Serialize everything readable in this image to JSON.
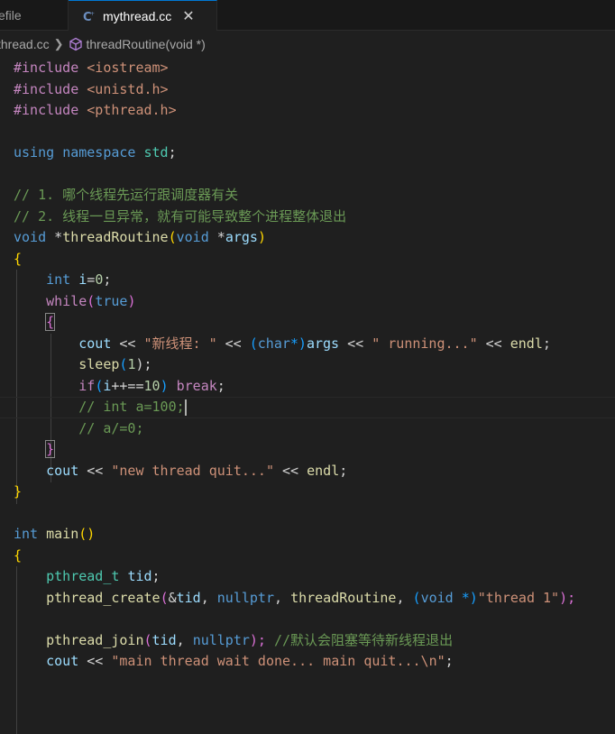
{
  "tabs": [
    {
      "label": "efile",
      "active": false
    },
    {
      "label": "mythread.cc",
      "active": true,
      "close": "✕"
    }
  ],
  "breadcrumb": {
    "file": "thread.cc",
    "symbol": "threadRoutine(void *)"
  },
  "code": {
    "l1": [
      "#include",
      " ",
      "<iostream>"
    ],
    "l2": [
      "#include",
      " ",
      "<unistd.h>"
    ],
    "l3": [
      "#include",
      " ",
      "<pthread.h>"
    ],
    "l5": [
      "using",
      "namespace",
      "std",
      ";"
    ],
    "l7": "// 1. 哪个线程先运行跟调度器有关",
    "l8": "// 2. 线程一旦异常，就有可能导致整个进程整体退出",
    "l9": [
      "void",
      "*",
      "threadRoutine",
      "(",
      "void",
      "*",
      "args",
      ")"
    ],
    "l11": [
      "int",
      "i",
      "=",
      "0",
      ";"
    ],
    "l12": [
      "while",
      "(",
      "true",
      ")"
    ],
    "l14": [
      "cout",
      " << ",
      "\"新线程: \"",
      " << ",
      "(",
      "char",
      "*)",
      "args",
      " << ",
      "\" running...\"",
      " << ",
      "endl",
      ";"
    ],
    "l15": [
      "sleep",
      "(",
      "1",
      ");"
    ],
    "l16": [
      "if",
      "(",
      "i",
      "++==",
      "10",
      ")",
      " ",
      "break",
      ";"
    ],
    "l17": "// int a=100;",
    "l18": "// a/=0;",
    "l20": [
      "cout",
      " << ",
      "\"new thread quit...\"",
      " << ",
      "endl",
      ";"
    ],
    "l23": [
      "int",
      "main",
      "()"
    ],
    "l25": [
      "pthread_t",
      "tid",
      ";"
    ],
    "l26": [
      "pthread_create",
      "(",
      "&",
      "tid",
      ", ",
      "nullptr",
      ", ",
      "threadRoutine",
      ", ",
      "(",
      "void",
      " *)",
      "\"thread 1\"",
      ");"
    ],
    "l28": [
      "pthread_join",
      "(",
      "tid",
      ", ",
      "nullptr",
      ");",
      " ",
      "//默认会阻塞等待新线程退出"
    ],
    "l29": [
      "cout",
      " << ",
      "\"main thread wait done... main quit...\\n\"",
      ";"
    ]
  },
  "colors": {
    "background": "#1f1f1f",
    "keyword": "#569cd6",
    "control": "#c586c0",
    "string": "#ce9178",
    "comment": "#6a9955",
    "function": "#dcdcaa",
    "variable": "#9cdcfe",
    "type": "#4ec9b0",
    "number": "#b5cea8"
  },
  "icons": {
    "file_icon": "cpp-file-icon",
    "symbol_icon": "method-cube-icon",
    "breadcrumb_sep": "chevron-right-icon"
  }
}
